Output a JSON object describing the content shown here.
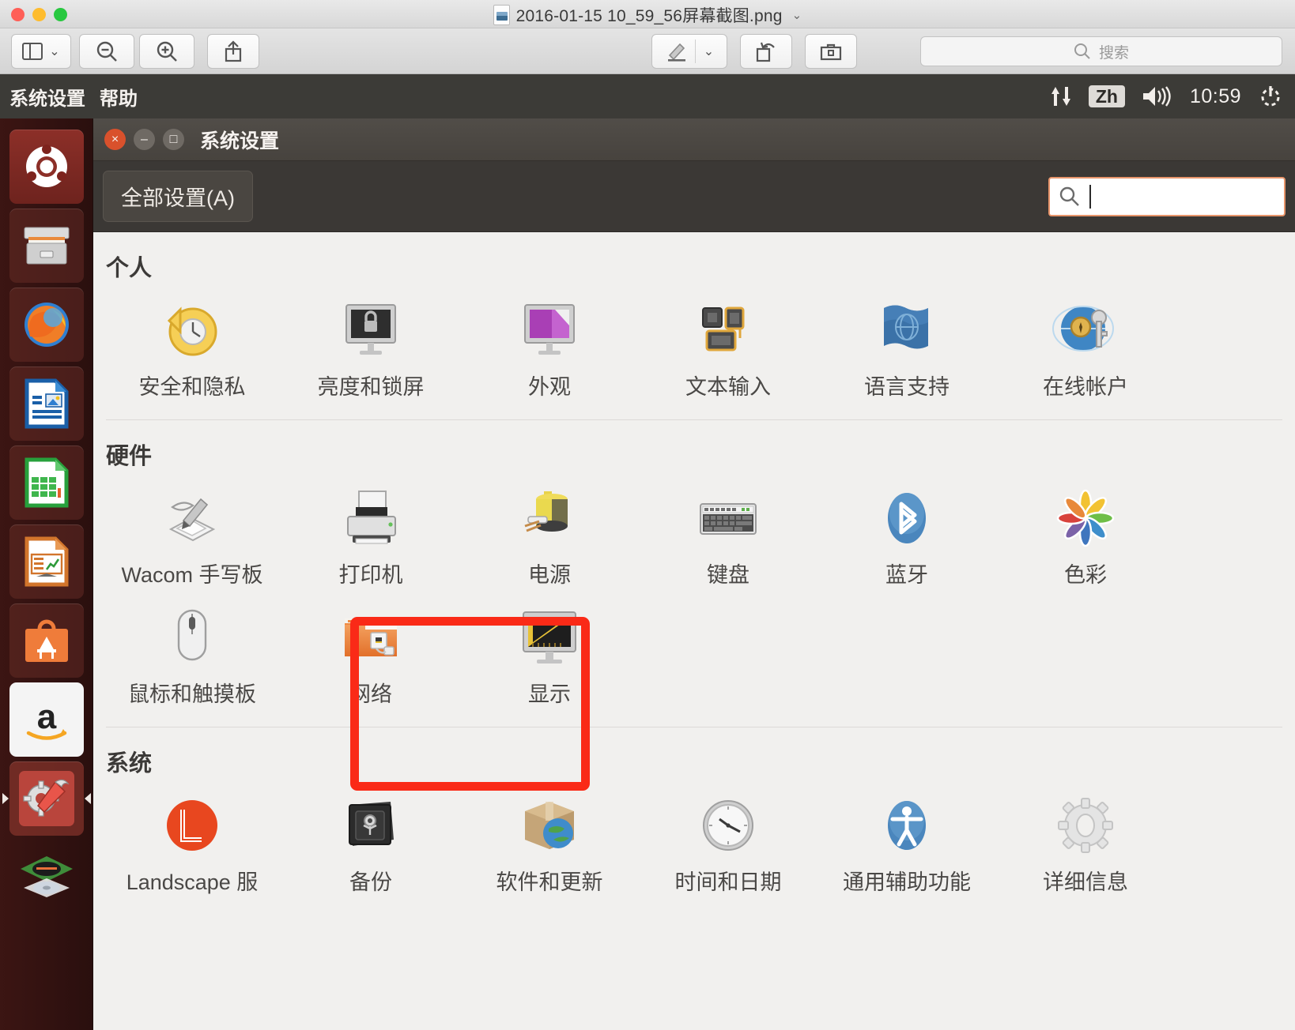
{
  "mac_window": {
    "filename": "2016-01-15 10_59_56屏幕截图.png",
    "title_chevron": "⌄",
    "file_icon": "image-file-icon",
    "traffic_lights": [
      "close",
      "minimize",
      "zoom"
    ],
    "toolbar": {
      "sidebar_label": "▯",
      "sidebar_chevron": "⌄",
      "zoom_out": "zoom-out-icon",
      "zoom_in": "zoom-in-icon",
      "share": "share-icon",
      "markup": "markup-pen-icon",
      "markup_chevron": "⌄",
      "rotate": "rotate-icon",
      "toolbox": "toolbox-icon"
    },
    "search": {
      "placeholder": "搜索",
      "value": "",
      "icon": "search-icon"
    }
  },
  "ubuntu_panel": {
    "menus": [
      "系统设置",
      "帮助"
    ],
    "indicators": {
      "network": "network-updown-icon",
      "input_method": "Zh",
      "volume": "volume-icon",
      "clock": "10:59",
      "session": "power-gear-icon"
    }
  },
  "launcher": {
    "items": [
      {
        "name": "ubuntu-dash",
        "label": "Dash 主页",
        "active": false
      },
      {
        "name": "files",
        "label": "文件",
        "active": false
      },
      {
        "name": "firefox",
        "label": "Firefox",
        "active": false
      },
      {
        "name": "libreoffice-writer",
        "label": "LibreOffice Writer",
        "active": false
      },
      {
        "name": "libreoffice-calc",
        "label": "LibreOffice Calc",
        "active": false
      },
      {
        "name": "libreoffice-impress",
        "label": "LibreOffice Impress",
        "active": false
      },
      {
        "name": "ubuntu-software-center",
        "label": "Ubuntu 软件中心",
        "active": false
      },
      {
        "name": "amazon",
        "label": "Amazon",
        "active": false
      },
      {
        "name": "system-settings",
        "label": "系统设置",
        "active": true
      },
      {
        "name": "workspace-switcher",
        "label": "工作区切换器",
        "active": false
      }
    ]
  },
  "settings_window": {
    "title": "系统设置",
    "buttons": {
      "close": "×",
      "minimize": "–",
      "maximize": "□"
    },
    "all_settings_label": "全部设置(A)",
    "search": {
      "placeholder": "",
      "value": "",
      "icon": "search-icon",
      "focused": true
    },
    "sections": [
      {
        "title": "个人",
        "items": [
          {
            "label": "安全和隐私",
            "icon": "security-privacy-icon"
          },
          {
            "label": "亮度和锁屏",
            "icon": "brightness-lock-icon"
          },
          {
            "label": "外观",
            "icon": "appearance-icon"
          },
          {
            "label": "文本输入",
            "icon": "text-entry-icon"
          },
          {
            "label": "语言支持",
            "icon": "language-support-icon"
          },
          {
            "label": "在线帐户",
            "icon": "online-accounts-icon"
          }
        ]
      },
      {
        "title": "硬件",
        "items": [
          {
            "label": "Wacom 手写板",
            "icon": "wacom-tablet-icon"
          },
          {
            "label": "打印机",
            "icon": "printer-icon"
          },
          {
            "label": "电源",
            "icon": "power-icon"
          },
          {
            "label": "键盘",
            "icon": "keyboard-icon"
          },
          {
            "label": "蓝牙",
            "icon": "bluetooth-icon"
          },
          {
            "label": "色彩",
            "icon": "color-icon"
          },
          {
            "label": "鼠标和触摸板",
            "icon": "mouse-touchpad-icon"
          },
          {
            "label": "网络",
            "icon": "network-folder-icon"
          },
          {
            "label": "显示",
            "icon": "displays-icon",
            "highlighted": true
          }
        ]
      },
      {
        "title": "系统",
        "items": [
          {
            "label": "Landscape 服",
            "icon": "landscape-service-icon"
          },
          {
            "label": "备份",
            "icon": "backup-safe-icon"
          },
          {
            "label": "软件和更新",
            "icon": "software-updates-icon"
          },
          {
            "label": "时间和日期",
            "icon": "time-date-icon"
          },
          {
            "label": "通用辅助功能",
            "icon": "universal-access-icon"
          },
          {
            "label": "详细信息",
            "icon": "details-gear-icon"
          }
        ]
      }
    ]
  },
  "annotation": {
    "type": "red-rectangle-highlight",
    "target_label": "显示",
    "color": "#fa2a17"
  }
}
